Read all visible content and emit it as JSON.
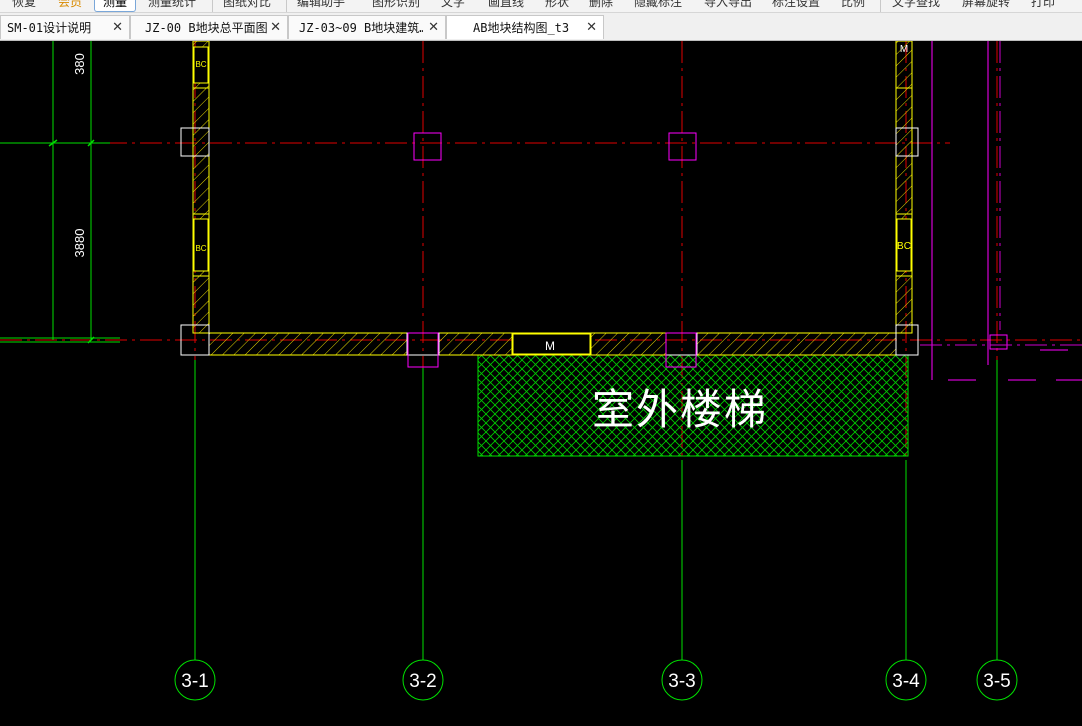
{
  "toolbar": {
    "items": [
      "恢复",
      "会员",
      "测量",
      "测量统计",
      "图纸对比",
      "编辑助手",
      "图形识别",
      "文字",
      "画直线",
      "形状",
      "删除",
      "隐藏标注",
      "导入导出",
      "标注设置",
      "比例",
      "文字查找",
      "屏幕旋转",
      "打印"
    ],
    "active_item": "测量",
    "member_color": "#d98b00"
  },
  "tabs": [
    {
      "label": "SM-01设计说明",
      "close": "✕"
    },
    {
      "label": "JZ-00 B地块总平面图",
      "close": "✕"
    },
    {
      "label": "JZ-03~09 B地块建筑…",
      "close": "✕"
    },
    {
      "label": "AB地块结构图_t3",
      "close": "✕"
    }
  ],
  "drawing": {
    "dimensions": [
      "380",
      "3880"
    ],
    "axis_labels": [
      "3-1",
      "3-2",
      "3-3",
      "3-4",
      "3-5"
    ],
    "wall_tags": [
      "BC",
      "BC",
      "BC",
      "M"
    ],
    "door_mark": "M",
    "stair_label": "室外楼梯",
    "colors": {
      "background": "#000000",
      "axis_line": "#ff0000",
      "grid_bubble": "#00ff00",
      "wall": "#ffff00",
      "column": "#ffffff",
      "opening": "#ff00ff",
      "stair_hatch": "#00cc00",
      "text": "#ffffff"
    }
  }
}
